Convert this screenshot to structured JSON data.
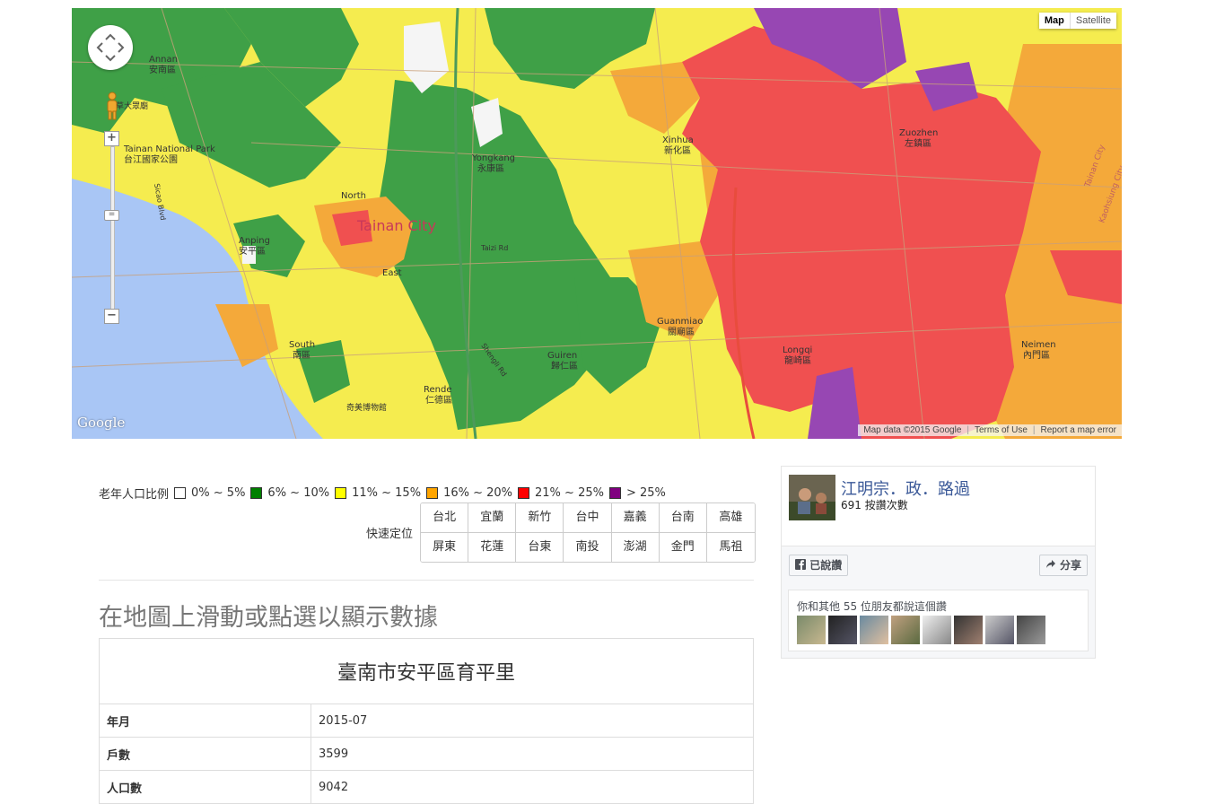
{
  "map": {
    "map_type": [
      "Map",
      "Satellite"
    ],
    "active_type": "Map",
    "zoom_in": "+",
    "zoom_out": "−",
    "slider_knob": "=",
    "logo": "Google",
    "attribution": {
      "data": "Map data ©2015 Google",
      "terms": "Terms of Use",
      "report": "Report a map error"
    },
    "place_labels": [
      {
        "text": "Annan",
        "cls": "g"
      },
      {
        "text": "安南區",
        "cls": "g"
      },
      {
        "text": "Tainan National Park",
        "cls": "g"
      },
      {
        "text": "台江國家公園",
        "cls": "g"
      },
      {
        "text": "Yongkang",
        "cls": "d"
      },
      {
        "text": "永康區",
        "cls": "d"
      },
      {
        "text": "Tainan City",
        "cls": "c"
      },
      {
        "text": "Anping",
        "cls": "d"
      },
      {
        "text": "安平區",
        "cls": "d"
      },
      {
        "text": "North",
        "cls": "d"
      },
      {
        "text": "East",
        "cls": "d"
      },
      {
        "text": "South",
        "cls": "d"
      },
      {
        "text": "南區",
        "cls": "d"
      },
      {
        "text": "Xinhua",
        "cls": "d"
      },
      {
        "text": "新化區",
        "cls": "d"
      },
      {
        "text": "Zuozhen",
        "cls": "d"
      },
      {
        "text": "左鎮區",
        "cls": "d"
      },
      {
        "text": "Guanmiao",
        "cls": "d"
      },
      {
        "text": "關廟區",
        "cls": "d"
      },
      {
        "text": "Guiren",
        "cls": "d"
      },
      {
        "text": "歸仁區",
        "cls": "d"
      },
      {
        "text": "Longqi",
        "cls": "d"
      },
      {
        "text": "龍崎區",
        "cls": "d"
      },
      {
        "text": "Neimen",
        "cls": "d"
      },
      {
        "text": "內門區",
        "cls": "d"
      },
      {
        "text": "Rende",
        "cls": "d"
      },
      {
        "text": "仁德區",
        "cls": "d"
      },
      {
        "text": "Taizi Rd",
        "cls": "r"
      },
      {
        "text": "Shengli Rd",
        "cls": "r"
      },
      {
        "text": "Sicao Blvd",
        "cls": "r"
      },
      {
        "text": "Tainan City",
        "cls": "r"
      },
      {
        "text": "Kaohsiung City",
        "cls": "r"
      },
      {
        "text": "奇美博物館",
        "cls": "g"
      },
      {
        "text": "四草大眾廟",
        "cls": "g"
      }
    ],
    "colors": {
      "white": "#f5f5f5",
      "green": "#3fa047",
      "yellow": "#f5ec4f",
      "orange": "#f4a93a",
      "red": "#f05050",
      "purple": "#9747b3",
      "sea": "#a9c6f5"
    }
  },
  "legend": {
    "title": "老年人口比例",
    "items": [
      {
        "label": "0% ~ 5%",
        "color": "#ffffff"
      },
      {
        "label": "6% ~ 10%",
        "color": "#008000"
      },
      {
        "label": "11% ~ 15%",
        "color": "#ffff00"
      },
      {
        "label": "16% ~ 20%",
        "color": "#ffa500"
      },
      {
        "label": "21% ~ 25%",
        "color": "#ff0000"
      },
      {
        "label": "> 25%",
        "color": "#800080"
      }
    ]
  },
  "quick_locate": {
    "label": "快速定位",
    "buttons": [
      "台北",
      "宜蘭",
      "新竹",
      "台中",
      "嘉義",
      "台南",
      "高雄",
      "屏東",
      "花蓮",
      "台東",
      "南投",
      "澎湖",
      "金門",
      "馬祖"
    ]
  },
  "heading": "在地圖上滑動或點選以顯示數據",
  "table": {
    "title": "臺南市安平區育平里",
    "rows": [
      {
        "key": "年月",
        "value": "2015-07"
      },
      {
        "key": "戶數",
        "value": "3599"
      },
      {
        "key": "人口數",
        "value": "9042"
      }
    ]
  },
  "facebook": {
    "page_name": "江明宗．政．路過",
    "likes": "691 按讚次數",
    "liked_button": "已說讚",
    "share_button": "分享",
    "friends_text": "你和其他 55 位朋友都說這個讚",
    "friend_avatar_count": 8
  }
}
